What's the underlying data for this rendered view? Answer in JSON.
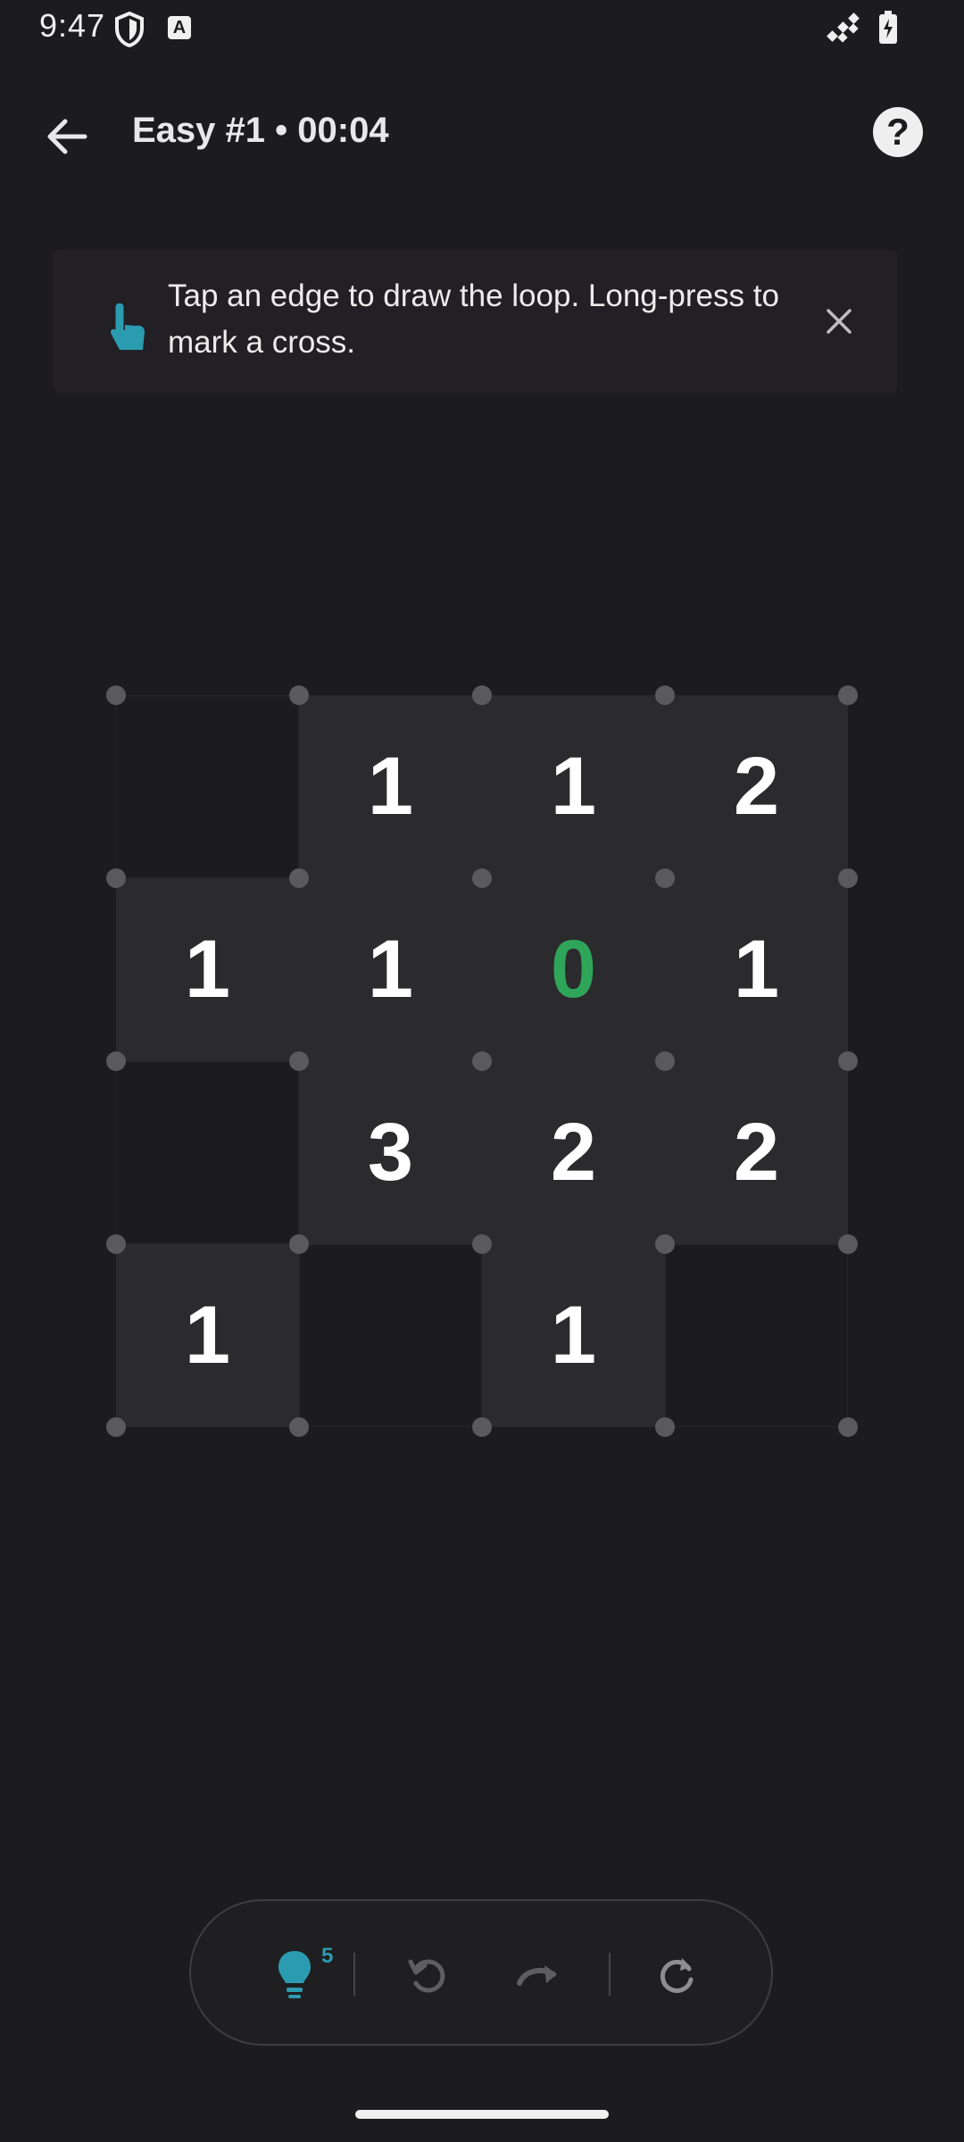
{
  "status_bar": {
    "time": "9:47",
    "icons": [
      "shield-icon",
      "font-a-icon",
      "signal-icon",
      "battery-charging-icon"
    ]
  },
  "app_bar": {
    "title": "Easy #1 • 00:04",
    "back_icon": "arrow-left-icon",
    "help_label": "?"
  },
  "hint_banner": {
    "text": "Tap an edge to draw the loop. Long-press to mark a cross.",
    "icon": "tap-hand-icon",
    "close_icon": "close-icon",
    "accent": "#2b9bb0"
  },
  "puzzle": {
    "rows": 4,
    "cols": 4,
    "cells": [
      [
        "",
        "1",
        "1",
        "2"
      ],
      [
        "1",
        "1",
        "0",
        "1"
      ],
      [
        "",
        "3",
        "2",
        "2"
      ],
      [
        "1",
        "",
        "1",
        ""
      ]
    ],
    "highlight_color": "#2fa55a",
    "highlighted": "0"
  },
  "toolbar": {
    "hint_count": "5",
    "buttons": [
      "lightbulb-icon",
      "undo-icon",
      "redo-icon",
      "restart-icon"
    ]
  }
}
